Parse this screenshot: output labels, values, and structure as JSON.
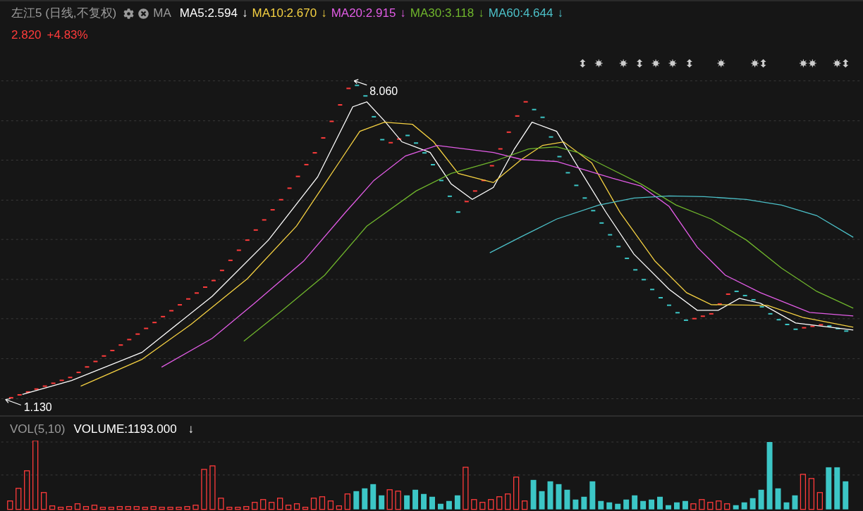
{
  "header": {
    "title": "左江5 (日线,不复权)",
    "indicator": "MA",
    "moving_averages": [
      {
        "label": "MA5:2.594",
        "arrow": "↓",
        "color": "#ffffff"
      },
      {
        "label": "MA10:2.670",
        "arrow": "↓",
        "color": "#f5d142"
      },
      {
        "label": "MA20:2.915",
        "arrow": "↓",
        "color": "#e25ce6"
      },
      {
        "label": "MA30:3.118",
        "arrow": "↓",
        "color": "#6fb52c"
      },
      {
        "label": "MA60:4.644",
        "arrow": "↓",
        "color": "#4cc0c8"
      }
    ]
  },
  "quote": {
    "price": "2.820",
    "change": "+4.83%"
  },
  "price_chart": {
    "high_label": "8.060",
    "low_label": "1.130"
  },
  "volume_panel": {
    "title": "VOL(5,10)",
    "volume": "VOLUME:1193.000",
    "arrow": "↓"
  }
}
